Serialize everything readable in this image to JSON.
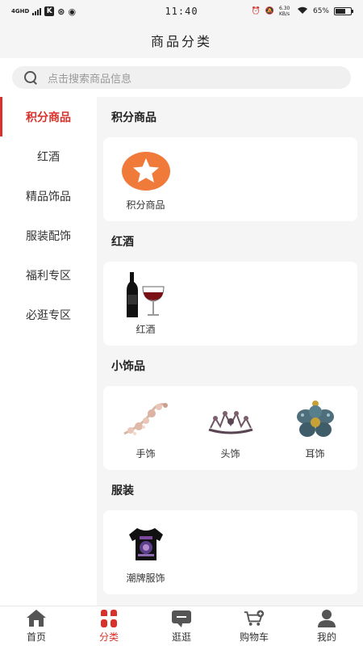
{
  "status_bar": {
    "network": "4GHD",
    "time": "11:40",
    "speed": "6.30 KB/s",
    "battery": "65%",
    "battery_level": 0.65,
    "icons": [
      "signal-icon",
      "k-app-icon",
      "weibo-icon",
      "q-app-icon",
      "alarm-icon",
      "mute-icon",
      "wifi-icon",
      "battery-icon"
    ]
  },
  "header": {
    "title": "商品分类"
  },
  "search": {
    "placeholder": "点击搜索商品信息"
  },
  "sidebar": {
    "items": [
      {
        "label": "积分商品",
        "active": true
      },
      {
        "label": "红酒"
      },
      {
        "label": "精品饰品"
      },
      {
        "label": "服装配饰"
      },
      {
        "label": "福利专区"
      },
      {
        "label": "必逛专区"
      }
    ]
  },
  "sections": [
    {
      "title": "积分商品",
      "items": [
        {
          "label": "积分商品",
          "icon": "star-badge-icon"
        }
      ]
    },
    {
      "title": "红酒",
      "items": [
        {
          "label": "红酒",
          "icon": "wine-icon"
        }
      ]
    },
    {
      "title": "小饰品",
      "items": [
        {
          "label": "手饰",
          "icon": "bracelet-icon"
        },
        {
          "label": "头饰",
          "icon": "tiara-icon"
        },
        {
          "label": "耳饰",
          "icon": "earring-icon"
        }
      ]
    },
    {
      "title": "服装",
      "items": [
        {
          "label": "潮牌服饰",
          "icon": "tshirt-icon"
        }
      ]
    }
  ],
  "tabbar": {
    "items": [
      {
        "label": "首页",
        "icon": "home-icon"
      },
      {
        "label": "分类",
        "icon": "category-icon",
        "active": true
      },
      {
        "label": "逛逛",
        "icon": "chat-icon"
      },
      {
        "label": "购物车",
        "icon": "cart-icon"
      },
      {
        "label": "我的",
        "icon": "user-icon"
      }
    ]
  },
  "colors": {
    "accent": "#d8312b",
    "star_orange": "#f07a3a"
  }
}
